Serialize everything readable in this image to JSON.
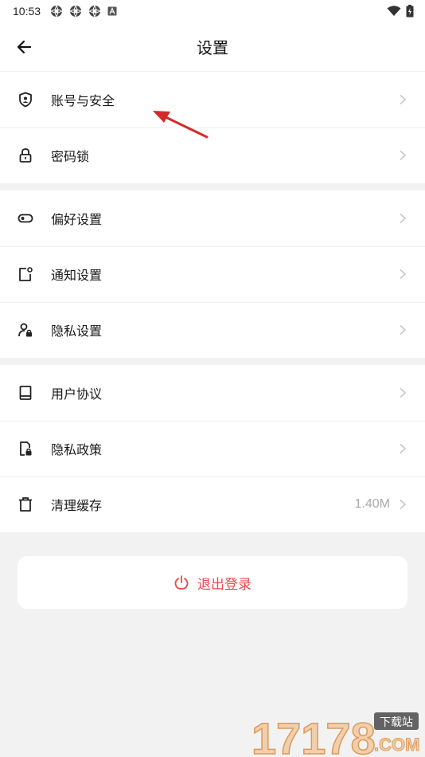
{
  "status": {
    "time": "10:53"
  },
  "header": {
    "title": "设置"
  },
  "groups": [
    {
      "items": [
        {
          "label": "账号与安全",
          "icon": "shield-user-icon"
        },
        {
          "label": "密码锁",
          "icon": "lock-icon"
        }
      ]
    },
    {
      "items": [
        {
          "label": "偏好设置",
          "icon": "toggle-icon"
        },
        {
          "label": "通知设置",
          "icon": "notification-icon"
        },
        {
          "label": "隐私设置",
          "icon": "user-lock-icon"
        }
      ]
    },
    {
      "items": [
        {
          "label": "用户协议",
          "icon": "book-icon"
        },
        {
          "label": "隐私政策",
          "icon": "document-lock-icon"
        },
        {
          "label": "清理缓存",
          "icon": "trash-icon",
          "value": "1.40M"
        }
      ]
    }
  ],
  "logout": {
    "label": "退出登录",
    "color": "#e94a4a"
  },
  "watermark": {
    "text": "17178",
    "badge": "下载站",
    "domain": ".COM"
  }
}
